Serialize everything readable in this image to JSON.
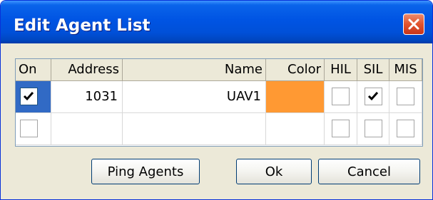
{
  "window": {
    "title": "Edit Agent List"
  },
  "table": {
    "columns": [
      "On",
      "Address",
      "Name",
      "Color",
      "HIL",
      "SIL",
      "MIS"
    ],
    "rows": [
      {
        "on": true,
        "address": "1031",
        "name": "UAV1",
        "color": "#ff9933",
        "hil": false,
        "sil": true,
        "mis": false
      },
      {
        "on": false,
        "address": "",
        "name": "",
        "color": "",
        "hil": false,
        "sil": false,
        "mis": false
      }
    ]
  },
  "buttons": {
    "ping": "Ping Agents",
    "ok": "Ok",
    "cancel": "Cancel"
  },
  "colors": {
    "titlebar": "#0054e3",
    "face": "#ece9d8",
    "focus": "#316ac5",
    "agent_color": "#ff9933"
  }
}
